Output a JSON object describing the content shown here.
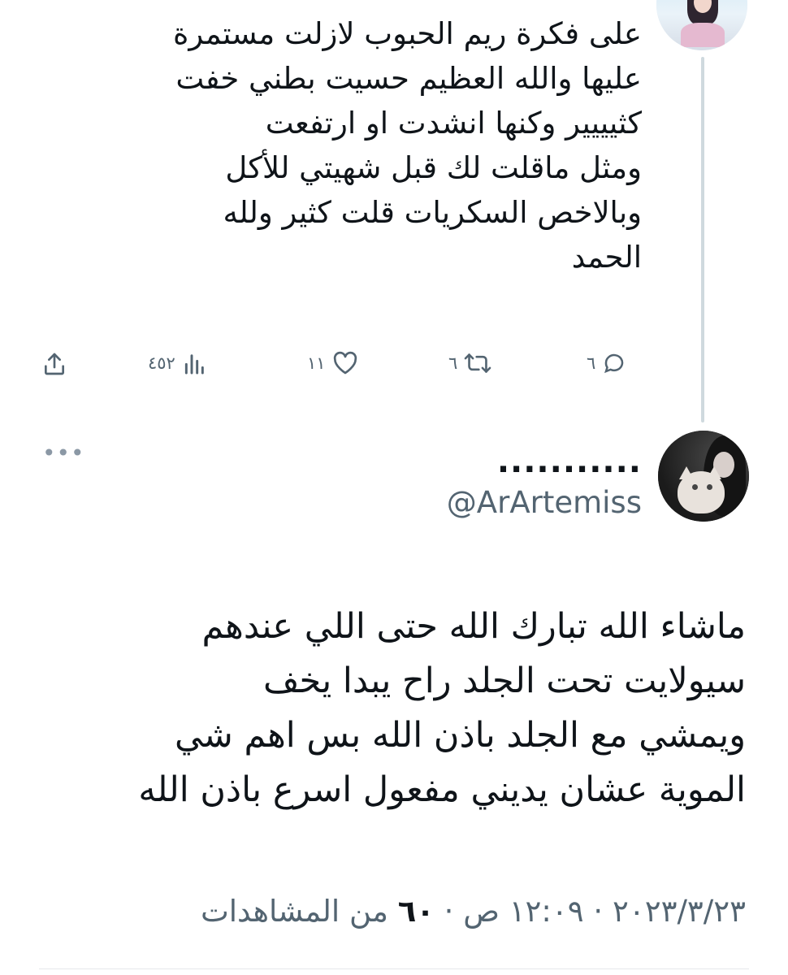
{
  "tweet1": {
    "lines": [
      "على فكرة ريم الحبوب لازلت مستمرة",
      "عليها والله العظيم حسيت بطني خفت",
      "كثيييير وكنها انشدت او ارتفعت",
      "ومثل ماقلت لك قبل شهيتي للأكل",
      "وبالاخص السكريات قلت كثير ولله",
      "الحمد"
    ],
    "actions": {
      "replies": "٦",
      "retweets": "٦",
      "likes": "١١",
      "views": "٤٥٢"
    },
    "icons": {
      "reply": "reply-icon",
      "retweet": "retweet-icon",
      "like": "heart-icon",
      "views": "views-icon",
      "share": "share-icon"
    }
  },
  "more_menu": "•••",
  "tweet2": {
    "display_name": "...........",
    "handle": "@ArArtemiss",
    "lines": [
      "ماشاء الله تبارك الله حتى اللي عندهم",
      "سيولايت تحت الجلد راح يبدا يخف",
      "ويمشي مع الجلد باذن الله بس اهم شي",
      "الموية عشان يديني مفعول اسرع باذن الله"
    ],
    "time": "١٢:٠٩ ص",
    "date": "٢٠٢٣/٣/٢٣",
    "separator": "·",
    "views_count": "٦٠",
    "views_label": "من المشاهدات"
  },
  "colors": {
    "text": "#0f1419",
    "secondary": "#536471",
    "thread_line": "#cfd9de"
  }
}
